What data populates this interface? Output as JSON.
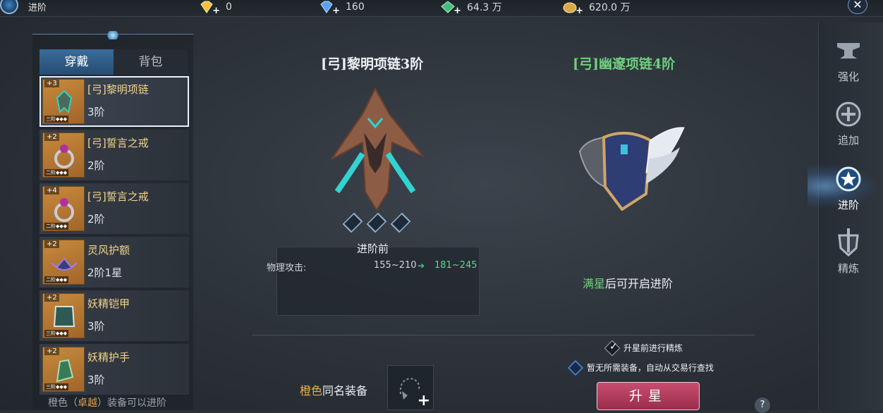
{
  "header": {
    "title": "进阶",
    "close_icon": "✕"
  },
  "currencies": [
    {
      "icon": "gold-diamond-icon",
      "value": "0",
      "color": "#f2c23a"
    },
    {
      "icon": "blue-diamond-icon",
      "value": "160",
      "color": "#5aa0f0"
    },
    {
      "icon": "green-gem-icon",
      "value": "64.3 万",
      "color": "#3fbf7a"
    },
    {
      "icon": "gold-coin-icon",
      "value": "620.0 万",
      "color": "#d9a94a"
    }
  ],
  "left_panel": {
    "tabs": [
      {
        "label": "穿戴",
        "active": true
      },
      {
        "label": "背包",
        "active": false
      }
    ],
    "items": [
      {
        "level": "+3",
        "name": "[弓]黎明项链",
        "stage": "3阶",
        "stars": "三阶◆◆◆",
        "icon": "necklace-icon",
        "selected": true
      },
      {
        "level": "+2",
        "name": "[弓]誓言之戒",
        "stage": "2阶",
        "stars": "二阶◆◆◆",
        "icon": "ring-icon",
        "selected": false
      },
      {
        "level": "+4",
        "name": "[弓]誓言之戒",
        "stage": "2阶",
        "stars": "二阶◆◆◆",
        "icon": "ring-icon",
        "selected": false
      },
      {
        "level": "+2",
        "name": "灵风护额",
        "stage": "2阶1星",
        "stars": "二阶◆◆◆",
        "icon": "circlet-icon",
        "selected": false
      },
      {
        "level": "+2",
        "name": "妖精铠甲",
        "stage": "3阶",
        "stars": "三阶◆◆◆",
        "icon": "armor-icon",
        "selected": false
      },
      {
        "level": "+2",
        "name": "妖精护手",
        "stage": "3阶",
        "stars": "三阶◆◆◆",
        "icon": "gauntlet-icon",
        "selected": false
      }
    ],
    "footer_prefix": "橙色（",
    "footer_highlight": "卓越",
    "footer_suffix": "）装备可以进阶"
  },
  "current_item": {
    "title": "[弓]黎明项链3阶",
    "before_label": "进阶前",
    "stat_name": "物理攻击:",
    "stat_old": "155~210",
    "stat_new": "181~245",
    "star_count": 3
  },
  "next_item": {
    "title": "[弓]幽邃项链4阶",
    "hint_green": "满星",
    "hint_rest": "后可开启进阶"
  },
  "material": {
    "label_highlight": "橙色",
    "label_rest": "同名装备",
    "plus": "+"
  },
  "options": {
    "refine_before_star": "升星前进行精炼",
    "auto_search": "暂无所需装备，自动从交易行查找"
  },
  "actions": {
    "star_up": "升星",
    "help": "?"
  },
  "right_nav": [
    {
      "label": "强化",
      "icon": "anvil-icon",
      "active": false
    },
    {
      "label": "追加",
      "icon": "shield-plus-icon",
      "active": false
    },
    {
      "label": "进阶",
      "icon": "star-emblem-icon",
      "active": true
    },
    {
      "label": "精炼",
      "icon": "sword-shield-icon",
      "active": false
    }
  ],
  "colors": {
    "accent_blue": "#3a6c9a",
    "name_gold": "#f2d48a",
    "upgrade_green": "#63d690",
    "button_red": "#b43d5e"
  }
}
